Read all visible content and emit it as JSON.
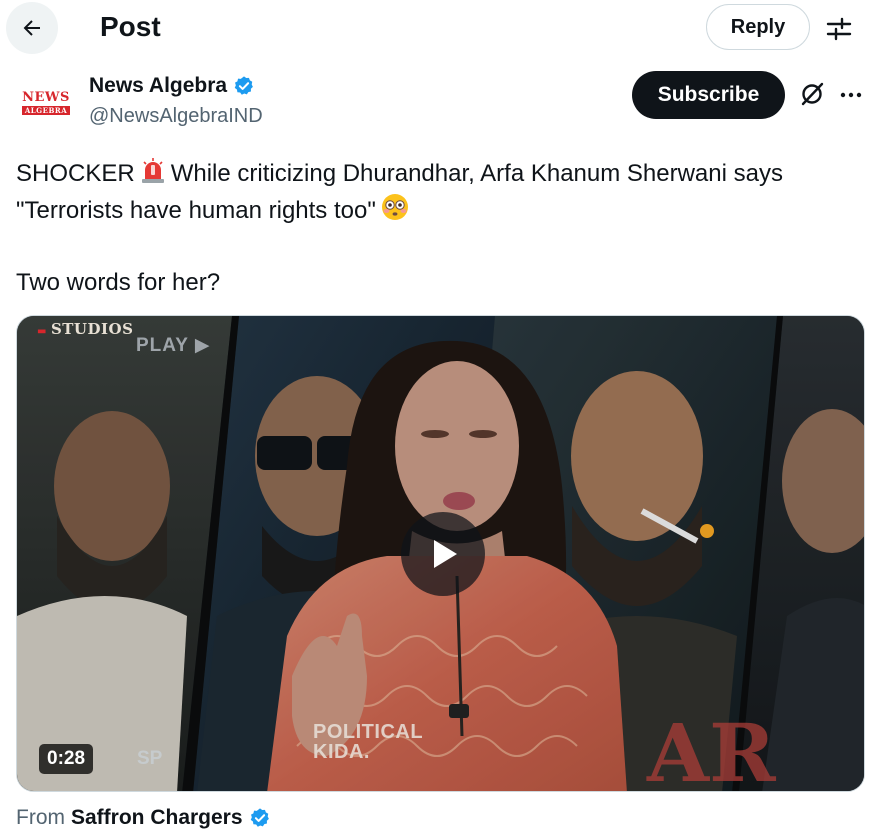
{
  "header": {
    "back_icon": "arrow-left-icon",
    "title": "Post",
    "reply_label": "Reply",
    "filter_icon": "sliders-icon"
  },
  "author": {
    "avatar_text_line1": "NEWS",
    "avatar_text_line2": "ALGEBRA",
    "name": "News Algebra",
    "handle": "@NewsAlgebraIND",
    "verified": true,
    "subscribe_label": "Subscribe",
    "grok_icon": "grok-icon",
    "more_icon": "more-horizontal-icon"
  },
  "post": {
    "line1_a": "SHOCKER",
    "line1_b": "While criticizing Dhurandhar, Arfa Khanum Sherwani says",
    "line2": "\"Terrorists have human rights too\"",
    "line3": "Two words for her?",
    "emoji_1": "police-light-emoji",
    "emoji_2": "flushed-face-emoji"
  },
  "media": {
    "studios_label": "STUDIOS",
    "play_label": "PLAY",
    "sp_label": "SP",
    "watermark_line1": "POLITICAL",
    "watermark_line2": "KIDA.",
    "duration": "0:28",
    "play_icon": "play-icon"
  },
  "footer": {
    "from_prefix": "From",
    "from_name": "Saffron Chargers",
    "verified": true
  },
  "colors": {
    "accent_blue": "#1d9bf0",
    "text_primary": "#0f1419",
    "text_secondary": "#536471",
    "brand_red": "#d7262c"
  }
}
